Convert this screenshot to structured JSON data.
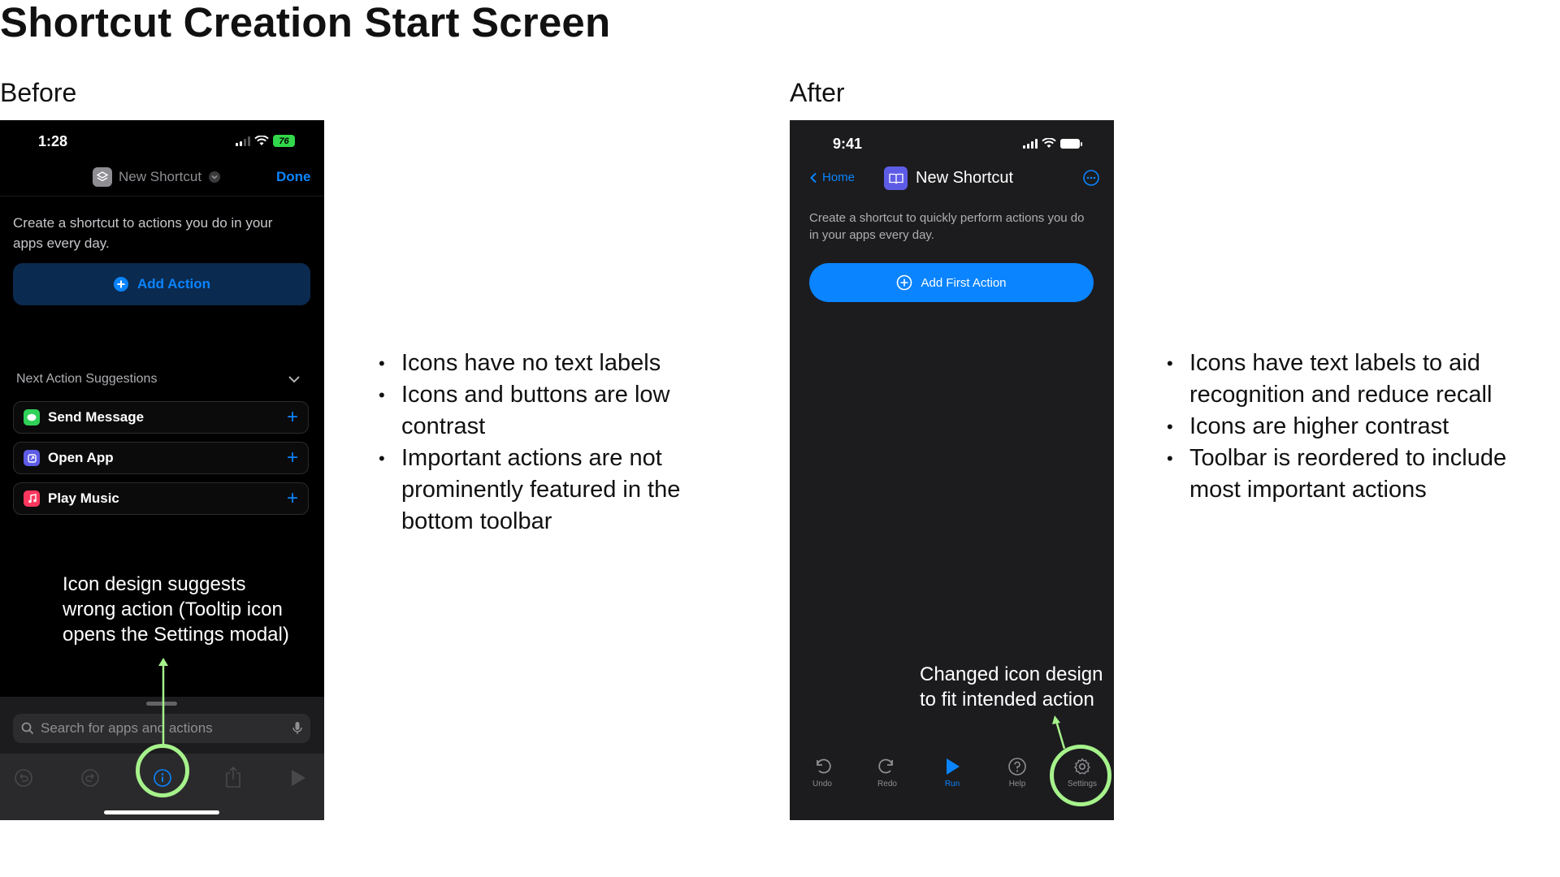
{
  "page": {
    "title": "Shortcut Creation Start Screen"
  },
  "before": {
    "label": "Before",
    "status": {
      "time": "1:28",
      "battery": "76"
    },
    "nav": {
      "title": "New Shortcut",
      "done": "Done"
    },
    "description": "Create a shortcut to actions you do in your apps every day.",
    "add_action": "Add Action",
    "suggestions": {
      "header": "Next Action Suggestions",
      "items": [
        {
          "label": "Send Message",
          "color": "#30d158"
        },
        {
          "label": "Open App",
          "color": "#5e5ce6"
        },
        {
          "label": "Play Music",
          "color": "#ff375f"
        }
      ]
    },
    "annotation": "Icon design suggests wrong action (Tooltip icon opens the Settings modal)",
    "search": {
      "placeholder": "Search for apps and actions"
    },
    "notes": [
      "Icons have no text labels",
      "Icons and buttons are low contrast",
      "Important actions are not prominently featured in the bottom toolbar"
    ]
  },
  "after": {
    "label": "After",
    "status": {
      "time": "9:41"
    },
    "nav": {
      "back": "Home",
      "title": "New Shortcut"
    },
    "description": "Create a shortcut to quickly perform actions you do in your apps every day.",
    "add_first_action": "Add First Action",
    "annotation": "Changed icon design to fit intended action",
    "toolbar": [
      {
        "label": "Undo",
        "icon": "undo-icon"
      },
      {
        "label": "Redo",
        "icon": "redo-icon"
      },
      {
        "label": "Run",
        "icon": "play-icon"
      },
      {
        "label": "Help",
        "icon": "help-icon"
      },
      {
        "label": "Settings",
        "icon": "gear-icon"
      }
    ],
    "notes": [
      "Icons have text labels to aid recognition and reduce recall",
      "Icons are higher contrast",
      "Toolbar is reordered to include most important actions"
    ]
  },
  "colors": {
    "accent": "#0a84ff",
    "highlight": "#a6f28b",
    "add_action_bg": "#0b2a4f"
  }
}
